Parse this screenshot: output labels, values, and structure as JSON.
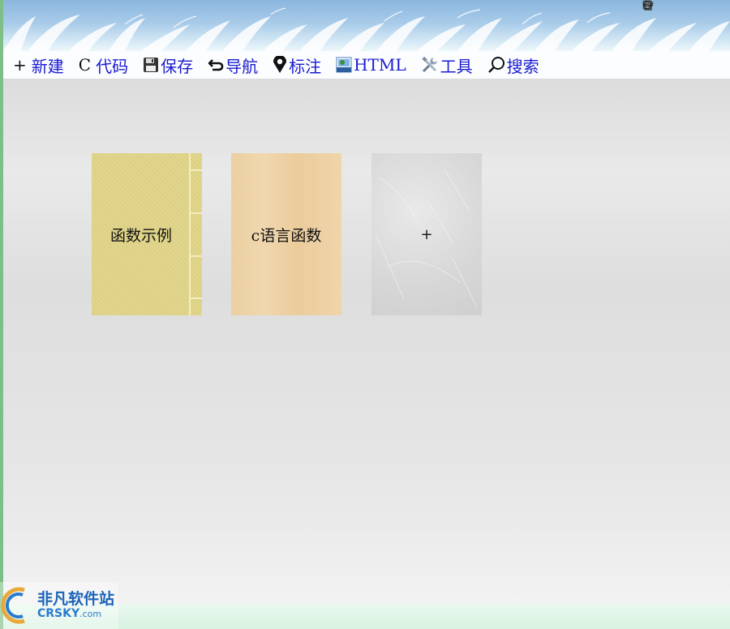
{
  "window": {
    "controls": [
      {
        "name": "home-icon"
      },
      {
        "name": "shirt-icon"
      },
      {
        "name": "minimize-icon"
      },
      {
        "name": "maximize-icon"
      },
      {
        "name": "close-icon"
      }
    ]
  },
  "toolbar": {
    "items": [
      {
        "icon": "plus-icon",
        "icon_text": "+",
        "label": "新建"
      },
      {
        "icon": "c-code-icon",
        "icon_text": "C",
        "label": "代码"
      },
      {
        "icon": "floppy-disk-icon",
        "label": "保存"
      },
      {
        "icon": "undo-arrow-icon",
        "label": "导航"
      },
      {
        "icon": "map-pin-icon",
        "label": "标注"
      },
      {
        "icon": "html-file-icon",
        "label": "HTML"
      },
      {
        "icon": "tools-icon",
        "label": "工具"
      },
      {
        "icon": "search-icon",
        "label": "搜索"
      }
    ]
  },
  "books": [
    {
      "title": "函数示例",
      "style": "yellow-bound"
    },
    {
      "title": "c语言函数",
      "style": "wood"
    },
    {
      "title": "+",
      "style": "add-new"
    }
  ],
  "watermark": {
    "cn": "非凡软件站",
    "en": "CRSKY",
    "en_suffix": ".com"
  },
  "colors": {
    "toolbar_text": "#1a1ad0",
    "banner_top": "#8ab6dd",
    "content_bg": "#e4e4e4"
  }
}
